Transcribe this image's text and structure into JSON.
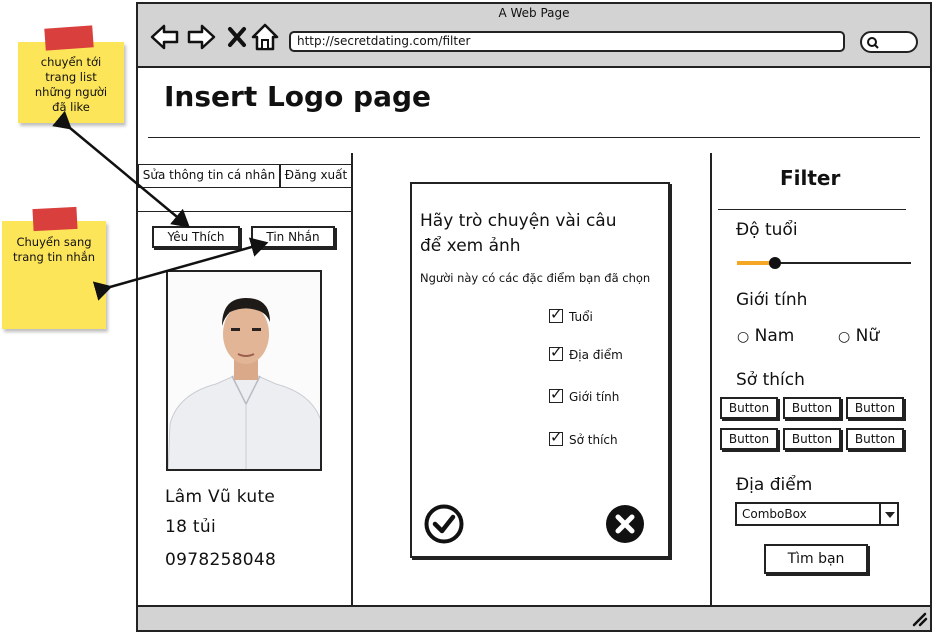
{
  "window": {
    "title": "A Web Page",
    "url": "http://secretdating.com/filter"
  },
  "header": {
    "logo": "Insert Logo page"
  },
  "left": {
    "edit_profile": "Sửa thông tin cá nhân",
    "logout": "Đăng xuất",
    "like": "Yêu Thích",
    "messages": "Tin Nhắn",
    "profile": {
      "name": "Lâm Vũ kute",
      "age": "18 tủi",
      "phone": "0978258048"
    }
  },
  "card": {
    "prompt": [
      "Hãy trò chuyện vài câu",
      "để xem ảnh"
    ],
    "subtitle": "Người này có các đặc điểm bạn đã chọn",
    "criteria": [
      "Tuổi",
      "Địa điểm",
      "Giới tính",
      "Sở thích"
    ]
  },
  "filter": {
    "title": "Filter",
    "age_label": "Độ tuổi",
    "age_value": 0.22,
    "gender_label": "Giới tính",
    "gender_options": [
      "Nam",
      "Nữ"
    ],
    "hobby_label": "Sở thích",
    "hobby_buttons": [
      "Button",
      "Button",
      "Button",
      "Button",
      "Button",
      "Button"
    ],
    "location_label": "Địa điểm",
    "location_value": "ComboBox",
    "search_button": "Tìm bạn"
  },
  "notes": {
    "note1": [
      "chuyển tới",
      "trang list",
      "những người",
      "đã like"
    ],
    "note2": [
      "Chuyển sang",
      "trang tin nhắn"
    ]
  },
  "colors": {
    "chrome": "#d3d3d3",
    "note": "#fde55a",
    "tape": "#d9403d",
    "slider_accent": "#f5a623"
  }
}
